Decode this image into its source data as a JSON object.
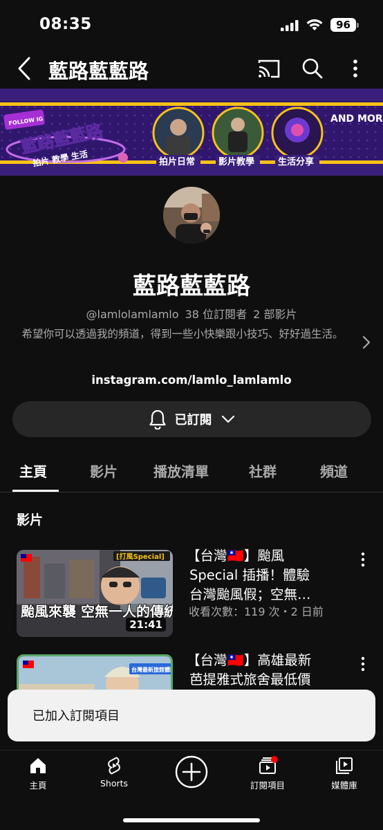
{
  "status_bar": {
    "time": "08:35",
    "battery": "96"
  },
  "app_bar": {
    "title": "藍路藍藍路"
  },
  "banner": {
    "follow": "FOLLOW IG",
    "logo_text": "藍路藍藍路",
    "logo_sub": "拍片 教學 生活",
    "items": [
      "拍片日常",
      "影片教學",
      "生活分享"
    ],
    "more": "AND MORE..."
  },
  "channel": {
    "name": "藍路藍藍路",
    "handle": "@lamlolamlamlo",
    "subscribers": "38 位訂閱者",
    "videos_count": "2 部影片",
    "description": "希望你可以透過我的頻道，得到一些小快樂跟小技巧、好好過生活。",
    "link": "instagram.com/lamlo_lamlamlo",
    "subscribed_label": "已訂閱"
  },
  "tabs": [
    "主頁",
    "影片",
    "播放清單",
    "社群",
    "頻道"
  ],
  "section_title": "影片",
  "videos": [
    {
      "title": "【台灣🇹🇼】颱風Special 插播！體驗台灣颱風假；空無…",
      "title_line1": "【台灣🇹🇼】颱風",
      "title_line2": "Special 插播！體驗",
      "title_line3": "台灣颱風假；空無…",
      "meta": "收看次數：119 次・2 日前",
      "duration": "21:41",
      "thumb_caption": "颱風來襲 空無一人的傳統",
      "thumb_tag": "[打風Special]"
    },
    {
      "title_line1": "【台灣🇹🇼】高雄最新",
      "title_line2": "芭提雅式旅舍最低價",
      "thumb_tag": "台灣最新旅館體驗"
    }
  ],
  "snackbar": {
    "text": "已加入訂閱項目"
  },
  "bottom_nav": {
    "home": "主頁",
    "shorts": "Shorts",
    "subscriptions": "訂閱項目",
    "library": "媒體庫"
  },
  "colors": {
    "background": "#0f0f0f",
    "accent_red": "#ff0000",
    "banner_purple": "#3a1f7a",
    "banner_yellow": "#f7c21a"
  }
}
